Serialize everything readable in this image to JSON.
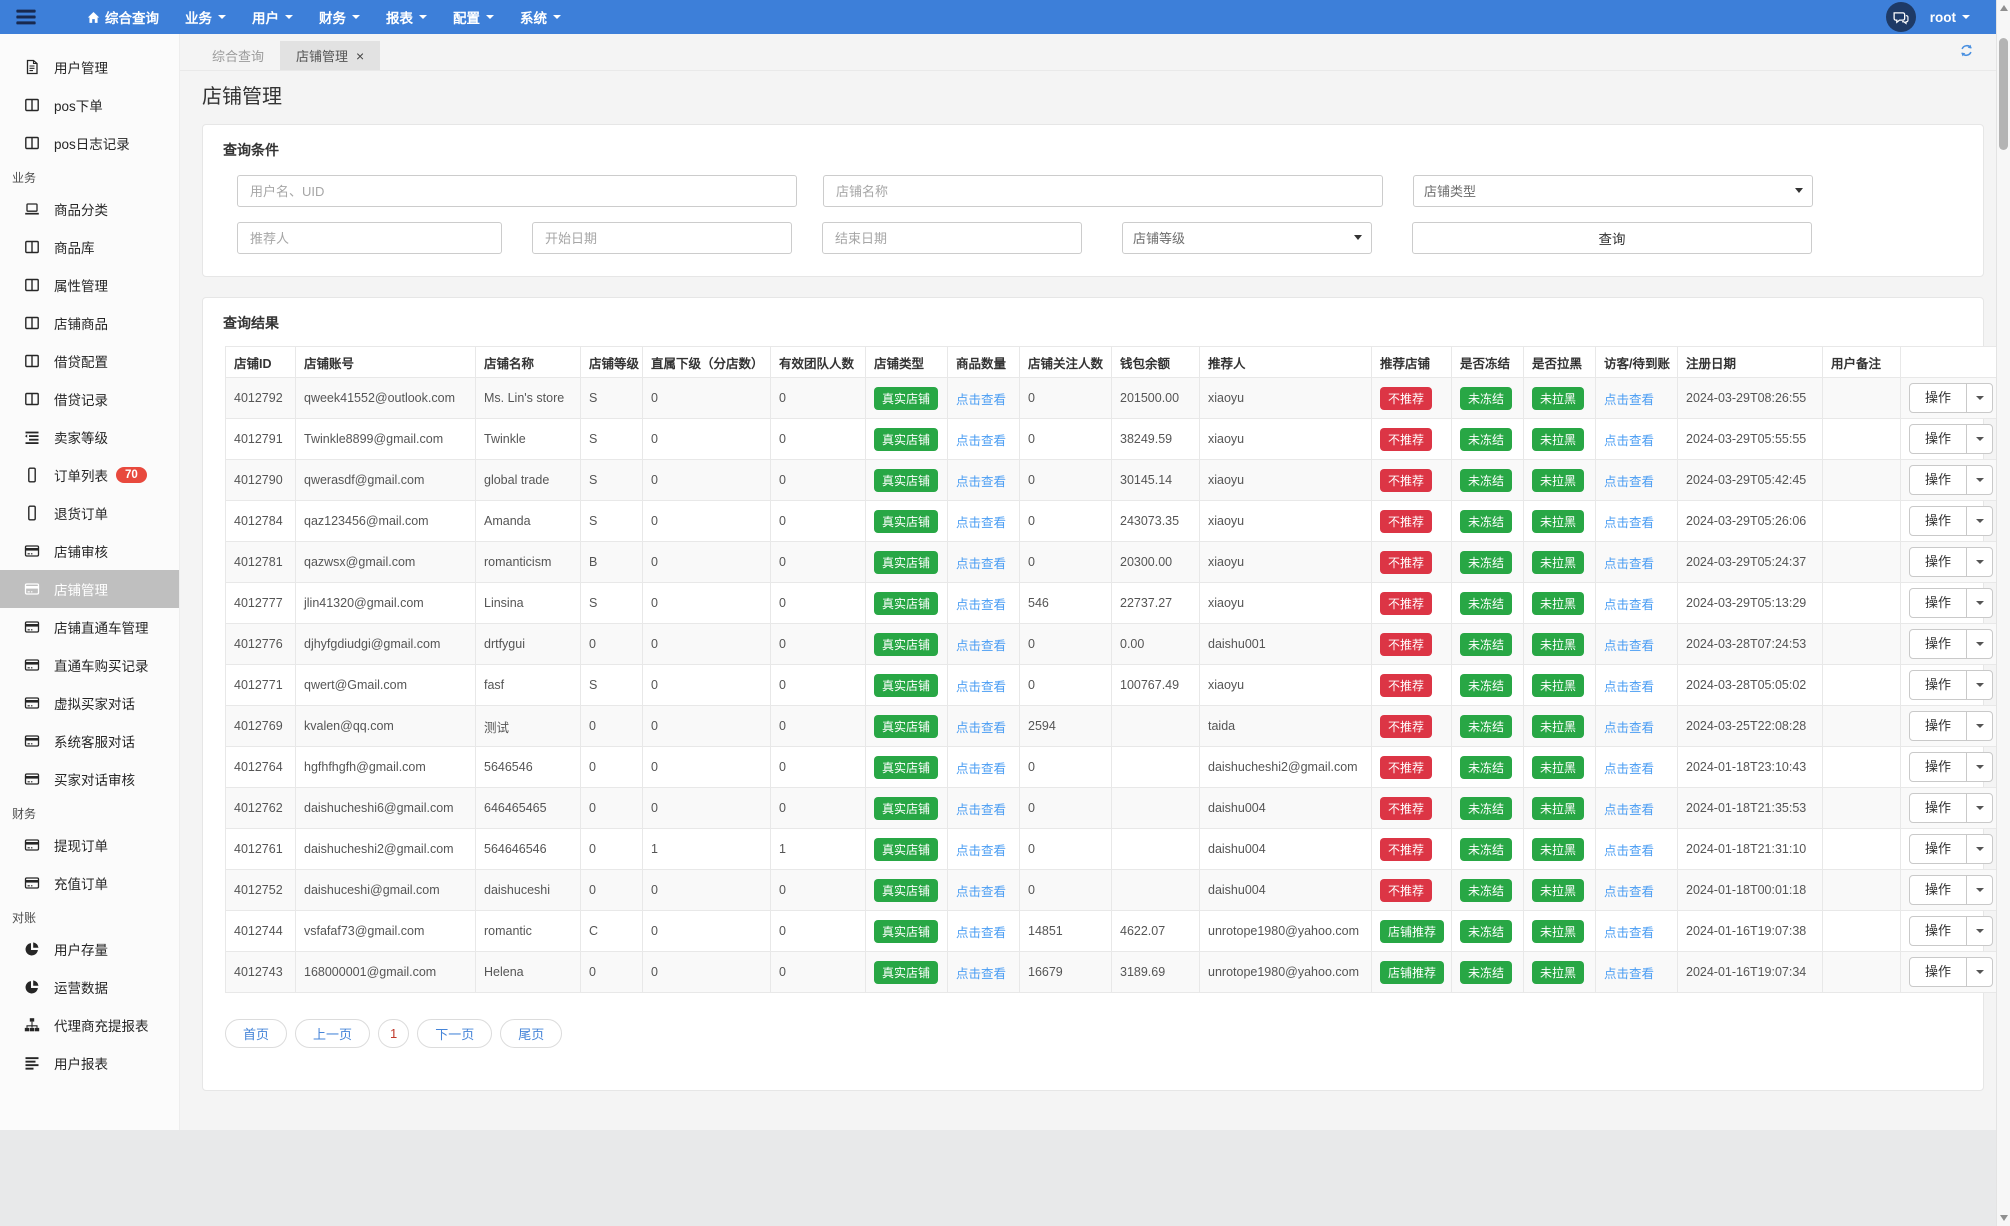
{
  "colors": {
    "navbar_blue": "#3d7fd9",
    "navy_icon": "#1d3156",
    "success_green": "#28a745",
    "danger_red": "#dc3545",
    "link_blue": "#4a9df3",
    "pagination_blue": "#4584d8",
    "sidebar_badge_red": "#e8493d",
    "active_sidebar_gray": "#bfbfbf"
  },
  "navbar": {
    "menu": [
      {
        "name": "overview-query",
        "label": "综合查询",
        "icon": "home",
        "caret": false
      },
      {
        "name": "business",
        "label": "业务",
        "caret": true
      },
      {
        "name": "users",
        "label": "用户",
        "caret": true
      },
      {
        "name": "finance",
        "label": "财务",
        "caret": true
      },
      {
        "name": "reports",
        "label": "报表",
        "caret": true
      },
      {
        "name": "config",
        "label": "配置",
        "caret": true
      },
      {
        "name": "system",
        "label": "系统",
        "caret": true
      }
    ],
    "username": "root"
  },
  "sidebar": {
    "items": [
      {
        "kind": "item",
        "name": "user-management",
        "icon": "file",
        "label": "用户管理"
      },
      {
        "kind": "item",
        "name": "pos-order",
        "icon": "columns",
        "label": "pos下单"
      },
      {
        "kind": "item",
        "name": "pos-log",
        "icon": "columns",
        "label": "pos日志记录"
      },
      {
        "kind": "section",
        "name": "section-business",
        "label": "业务"
      },
      {
        "kind": "item",
        "name": "goods-category",
        "icon": "laptop",
        "label": "商品分类"
      },
      {
        "kind": "item",
        "name": "goods-library",
        "icon": "columns",
        "label": "商品库"
      },
      {
        "kind": "item",
        "name": "attribute-management",
        "icon": "columns",
        "label": "属性管理"
      },
      {
        "kind": "item",
        "name": "shop-goods",
        "icon": "columns",
        "label": "店铺商品"
      },
      {
        "kind": "item",
        "name": "loan-config",
        "icon": "columns",
        "label": "借贷配置"
      },
      {
        "kind": "item",
        "name": "loan-records",
        "icon": "columns",
        "label": "借贷记录"
      },
      {
        "kind": "item",
        "name": "seller-level",
        "icon": "list",
        "label": "卖家等级"
      },
      {
        "kind": "item",
        "name": "order-list",
        "icon": "mobile",
        "label": "订单列表",
        "badge": "70"
      },
      {
        "kind": "item",
        "name": "return-orders",
        "icon": "mobile",
        "label": "退货订单"
      },
      {
        "kind": "item",
        "name": "shop-review",
        "icon": "card",
        "label": "店铺审核"
      },
      {
        "kind": "item",
        "name": "shop-management",
        "icon": "card",
        "label": "店铺管理",
        "active": true
      },
      {
        "kind": "item",
        "name": "shop-through-train",
        "icon": "card",
        "label": "店铺直通车管理"
      },
      {
        "kind": "item",
        "name": "through-train-purchase",
        "icon": "card",
        "label": "直通车购买记录"
      },
      {
        "kind": "item",
        "name": "virtual-buyer-chat",
        "icon": "card",
        "label": "虚拟买家对话"
      },
      {
        "kind": "item",
        "name": "system-service-chat",
        "icon": "card",
        "label": "系统客服对话"
      },
      {
        "kind": "item",
        "name": "buyer-chat-review",
        "icon": "card",
        "label": "买家对话审核"
      },
      {
        "kind": "section",
        "name": "section-finance",
        "label": "财务"
      },
      {
        "kind": "item",
        "name": "withdraw-orders",
        "icon": "card",
        "label": "提现订单"
      },
      {
        "kind": "item",
        "name": "recharge-orders",
        "icon": "card",
        "label": "充值订单"
      },
      {
        "kind": "section",
        "name": "section-reconciliation",
        "label": "对账"
      },
      {
        "kind": "item",
        "name": "user-stock",
        "icon": "pie",
        "label": "用户存量"
      },
      {
        "kind": "item",
        "name": "operation-data",
        "icon": "pie",
        "label": "运营数据"
      },
      {
        "kind": "item",
        "name": "agent-recharge-report",
        "icon": "sitemap",
        "label": "代理商充提报表"
      },
      {
        "kind": "item",
        "name": "user-report",
        "icon": "bars",
        "label": "用户报表"
      }
    ]
  },
  "tabs": [
    {
      "name": "overview-query",
      "label": "综合查询",
      "active": false,
      "closable": false
    },
    {
      "name": "shop-management",
      "label": "店铺管理",
      "active": true,
      "closable": true
    }
  ],
  "page": {
    "title": "店铺管理"
  },
  "query": {
    "panel_title": "查询条件",
    "row1": [
      {
        "type": "input",
        "name": "username-uid-input",
        "placeholder": "用户名、UID",
        "value": ""
      },
      {
        "type": "input",
        "name": "shop-name-input",
        "placeholder": "店铺名称",
        "value": ""
      },
      {
        "type": "select",
        "name": "shop-type-select",
        "value": "店铺类型"
      }
    ],
    "row2": [
      {
        "type": "input",
        "name": "referrer-input",
        "placeholder": "推荐人",
        "value": ""
      },
      {
        "type": "input",
        "name": "start-date-input",
        "placeholder": "开始日期",
        "value": ""
      },
      {
        "type": "input",
        "name": "end-date-input",
        "placeholder": "结束日期",
        "value": ""
      },
      {
        "type": "select",
        "name": "shop-level-select",
        "value": "店铺等级"
      },
      {
        "type": "button",
        "name": "search-button",
        "label": "查询"
      }
    ]
  },
  "results": {
    "panel_title": "查询结果",
    "columns": [
      "店铺ID",
      "店铺账号",
      "店铺名称",
      "店铺等级",
      "直属下级（分店数）",
      "有效团队人数",
      "店铺类型",
      "商品数量",
      "店铺关注人数",
      "钱包余额",
      "推荐人",
      "推荐店铺",
      "是否冻结",
      "是否拉黑",
      "访客/待到账",
      "注册日期",
      "用户备注",
      ""
    ],
    "common": {
      "type_badge": "真实店铺",
      "view_link": "点击查看",
      "freeze_badge": "未冻结",
      "blacklist_badge": "未拉黑",
      "action_label": "操作"
    },
    "rows": [
      {
        "id": "4012792",
        "account": "qweek41552@outlook.com",
        "shop": "Ms. Lin's store",
        "level": "S",
        "sub": "0",
        "team": "0",
        "followers": "0",
        "balance": "201500.00",
        "referrer": "xiaoyu",
        "recommend": "不推荐",
        "rec_type": "danger",
        "date": "2024-03-29T08:26:55",
        "remark": ""
      },
      {
        "id": "4012791",
        "account": "Twinkle8899@gmail.com",
        "shop": "Twinkle",
        "level": "S",
        "sub": "0",
        "team": "0",
        "followers": "0",
        "balance": "38249.59",
        "referrer": "xiaoyu",
        "recommend": "不推荐",
        "rec_type": "danger",
        "date": "2024-03-29T05:55:55",
        "remark": ""
      },
      {
        "id": "4012790",
        "account": "qwerasdf@gmail.com",
        "shop": "global trade",
        "level": "S",
        "sub": "0",
        "team": "0",
        "followers": "0",
        "balance": "30145.14",
        "referrer": "xiaoyu",
        "recommend": "不推荐",
        "rec_type": "danger",
        "date": "2024-03-29T05:42:45",
        "remark": ""
      },
      {
        "id": "4012784",
        "account": "qaz123456@mail.com",
        "shop": "Amanda",
        "level": "S",
        "sub": "0",
        "team": "0",
        "followers": "0",
        "balance": "243073.35",
        "referrer": "xiaoyu",
        "recommend": "不推荐",
        "rec_type": "danger",
        "date": "2024-03-29T05:26:06",
        "remark": ""
      },
      {
        "id": "4012781",
        "account": "qazwsx@gmail.com",
        "shop": "romanticism",
        "level": "B",
        "sub": "0",
        "team": "0",
        "followers": "0",
        "balance": "20300.00",
        "referrer": "xiaoyu",
        "recommend": "不推荐",
        "rec_type": "danger",
        "date": "2024-03-29T05:24:37",
        "remark": ""
      },
      {
        "id": "4012777",
        "account": "jlin41320@gmail.com",
        "shop": "Linsina",
        "level": "S",
        "sub": "0",
        "team": "0",
        "followers": "546",
        "balance": "22737.27",
        "referrer": "xiaoyu",
        "recommend": "不推荐",
        "rec_type": "danger",
        "date": "2024-03-29T05:13:29",
        "remark": ""
      },
      {
        "id": "4012776",
        "account": "djhyfgdiudgi@gmail.com",
        "shop": "drtfygui",
        "level": "0",
        "sub": "0",
        "team": "0",
        "followers": "0",
        "balance": "0.00",
        "referrer": "daishu001",
        "recommend": "不推荐",
        "rec_type": "danger",
        "date": "2024-03-28T07:24:53",
        "remark": ""
      },
      {
        "id": "4012771",
        "account": "qwert@Gmail.com",
        "shop": "fasf",
        "level": "S",
        "sub": "0",
        "team": "0",
        "followers": "0",
        "balance": "100767.49",
        "referrer": "xiaoyu",
        "recommend": "不推荐",
        "rec_type": "danger",
        "date": "2024-03-28T05:05:02",
        "remark": ""
      },
      {
        "id": "4012769",
        "account": "kvalen@qq.com",
        "shop": "测试",
        "level": "0",
        "sub": "0",
        "team": "0",
        "followers": "2594",
        "balance": "",
        "referrer": "taida",
        "recommend": "不推荐",
        "rec_type": "danger",
        "date": "2024-03-25T22:08:28",
        "remark": ""
      },
      {
        "id": "4012764",
        "account": "hgfhfhgfh@gmail.com",
        "shop": "5646546",
        "level": "0",
        "sub": "0",
        "team": "0",
        "followers": "0",
        "balance": "",
        "referrer": "daishucheshi2@gmail.com",
        "recommend": "不推荐",
        "rec_type": "danger",
        "date": "2024-01-18T23:10:43",
        "remark": ""
      },
      {
        "id": "4012762",
        "account": "daishucheshi6@gmail.com",
        "shop": "646465465",
        "level": "0",
        "sub": "0",
        "team": "0",
        "followers": "0",
        "balance": "",
        "referrer": "daishu004",
        "recommend": "不推荐",
        "rec_type": "danger",
        "date": "2024-01-18T21:35:53",
        "remark": ""
      },
      {
        "id": "4012761",
        "account": "daishucheshi2@gmail.com",
        "shop": "564646546",
        "level": "0",
        "sub": "1",
        "team": "1",
        "followers": "0",
        "balance": "",
        "referrer": "daishu004",
        "recommend": "不推荐",
        "rec_type": "danger",
        "date": "2024-01-18T21:31:10",
        "remark": ""
      },
      {
        "id": "4012752",
        "account": "daishuceshi@gmail.com",
        "shop": "daishuceshi",
        "level": "0",
        "sub": "0",
        "team": "0",
        "followers": "0",
        "balance": "",
        "referrer": "daishu004",
        "recommend": "不推荐",
        "rec_type": "danger",
        "date": "2024-01-18T00:01:18",
        "remark": ""
      },
      {
        "id": "4012744",
        "account": "vsfafaf73@gmail.com",
        "shop": "romantic",
        "level": "C",
        "sub": "0",
        "team": "0",
        "followers": "14851",
        "balance": "4622.07",
        "referrer": "unrotope1980@yahoo.com",
        "recommend": "店铺推荐",
        "rec_type": "success",
        "date": "2024-01-16T19:07:38",
        "remark": ""
      },
      {
        "id": "4012743",
        "account": "168000001@gmail.com",
        "shop": "Helena",
        "level": "0",
        "sub": "0",
        "team": "0",
        "followers": "16679",
        "balance": "3189.69",
        "referrer": "unrotope1980@yahoo.com",
        "recommend": "店铺推荐",
        "rec_type": "success",
        "date": "2024-01-16T19:07:34",
        "remark": ""
      }
    ],
    "pagination": [
      {
        "name": "first-page",
        "label": "首页",
        "current": false
      },
      {
        "name": "prev-page",
        "label": "上一页",
        "current": false
      },
      {
        "name": "page-1",
        "label": "1",
        "current": true
      },
      {
        "name": "next-page",
        "label": "下一页",
        "current": false
      },
      {
        "name": "last-page",
        "label": "尾页",
        "current": false
      }
    ]
  }
}
